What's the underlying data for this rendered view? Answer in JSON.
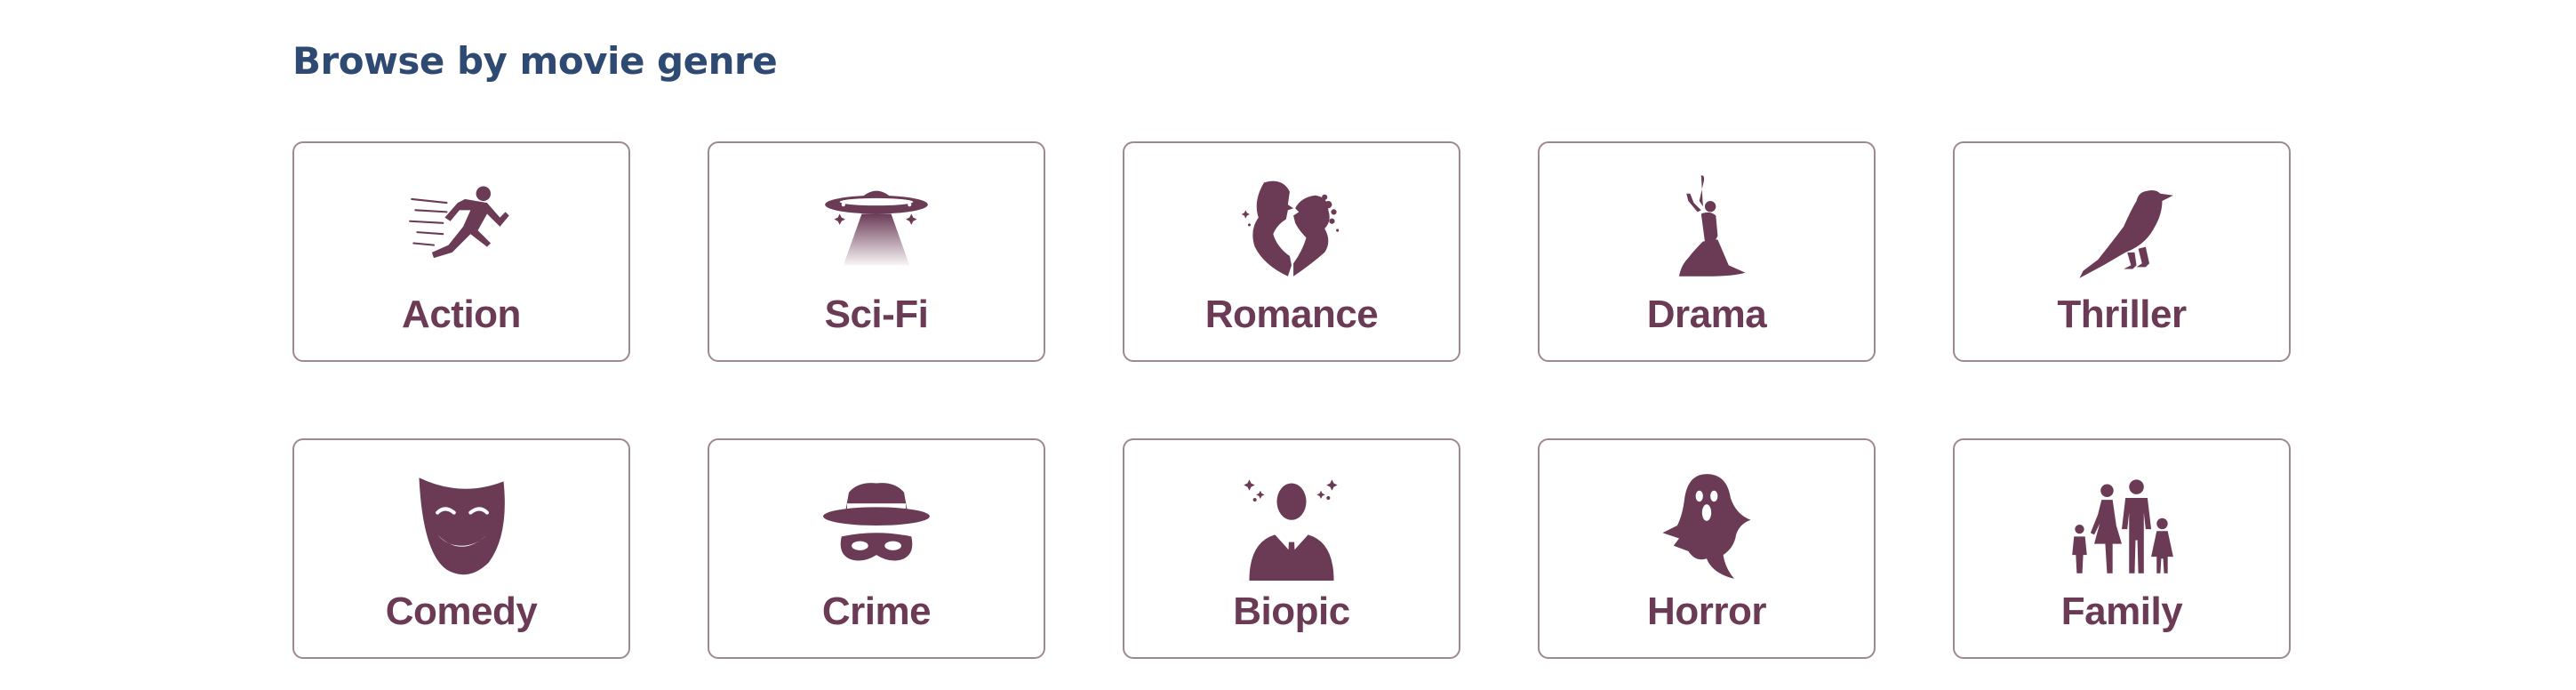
{
  "page": {
    "heading": "Browse by movie genre"
  },
  "colors": {
    "heading": "#2f4a72",
    "accent": "#6b3b56",
    "card_border": "#a08893"
  },
  "genres": [
    {
      "label": "Action",
      "icon": "running-man-icon"
    },
    {
      "label": "Sci-Fi",
      "icon": "ufo-icon"
    },
    {
      "label": "Romance",
      "icon": "kissing-couple-icon"
    },
    {
      "label": "Drama",
      "icon": "dancer-icon"
    },
    {
      "label": "Thriller",
      "icon": "raven-icon"
    },
    {
      "label": "Comedy",
      "icon": "comedy-mask-icon"
    },
    {
      "label": "Crime",
      "icon": "masked-criminal-icon"
    },
    {
      "label": "Biopic",
      "icon": "businessman-icon"
    },
    {
      "label": "Horror",
      "icon": "ghost-icon"
    },
    {
      "label": "Family",
      "icon": "family-icon"
    }
  ]
}
